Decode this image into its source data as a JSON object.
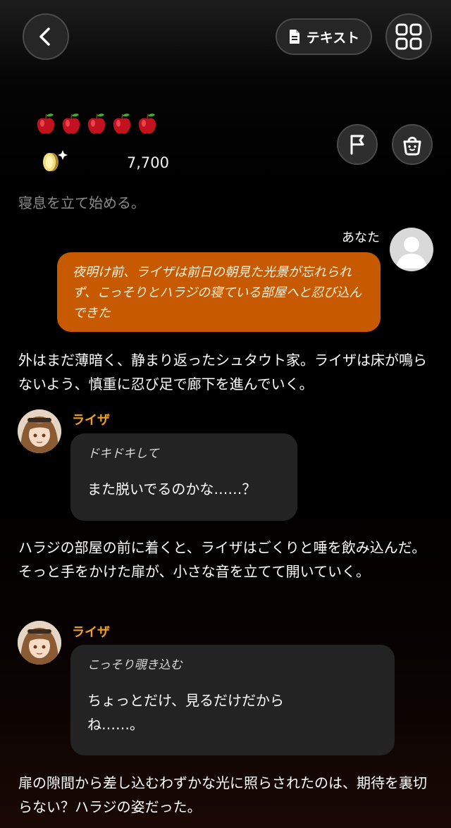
{
  "header": {
    "text_button_label": "テキスト",
    "back_icon": "chevron-left-icon",
    "menu_icon": "grid-icon"
  },
  "status": {
    "apple_count": 5,
    "coin_count": "7,700",
    "icons": [
      "flag-icon",
      "bag-icon"
    ]
  },
  "faded_line": "寝息を立て始める。",
  "user_message": {
    "name": "あなた",
    "text": "夜明け前、ライザは前日の朝見た光景が忘れられず、こっそりとハラジの寝ている部屋へと忍び込んできた"
  },
  "narration_1": "外はまだ薄暗く、静まり返ったシュタウト家。ライザは床が鳴らないよう、慎重に忍び足で廊下を進んでいく。",
  "char_message_1": {
    "name": "ライザ",
    "action": "ドキドキして",
    "speech": "また脱いでるのかな……？"
  },
  "narration_2": "ハラジの部屋の前に着くと、ライザはごくりと唾を飲み込んだ。そっと手をかけた扉が、小さな音を立てて開いていく。",
  "char_message_2": {
    "name": "ライザ",
    "action": "こっそり覗き込む",
    "speech": "ちょっとだけ、見るだけだからね……。"
  },
  "narration_3": "扉の隙間から差し込むわずかな光に照らされたのは、期待を裏切らない？ハラジの姿だった。",
  "colors": {
    "user_bubble": "#c75a00",
    "char_name": "#f0a11c",
    "char_bubble": "#232323"
  }
}
